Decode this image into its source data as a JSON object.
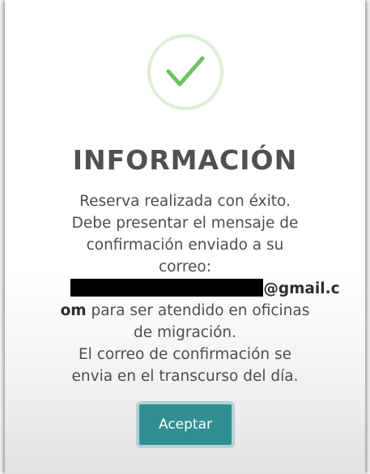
{
  "dialog": {
    "icon": "check-icon",
    "success_color": "#6dc45f",
    "title": "INFORMACIÓN",
    "message": {
      "line1": "Reserva realizada con éxito.",
      "line2": "Debe presentar el mensaje de",
      "line3": "confirmación enviado a su",
      "line4": "correo:",
      "email_suffix": "@gmail.c",
      "email_suffix_cont": "om",
      "line6_rest": " para ser atendido en oficinas",
      "line7": "de migración.",
      "line8": "El correo de confirmación se",
      "line9": "envia en el transcurso del día."
    },
    "button": {
      "label": "Aceptar",
      "color": "#2f8f93"
    }
  }
}
